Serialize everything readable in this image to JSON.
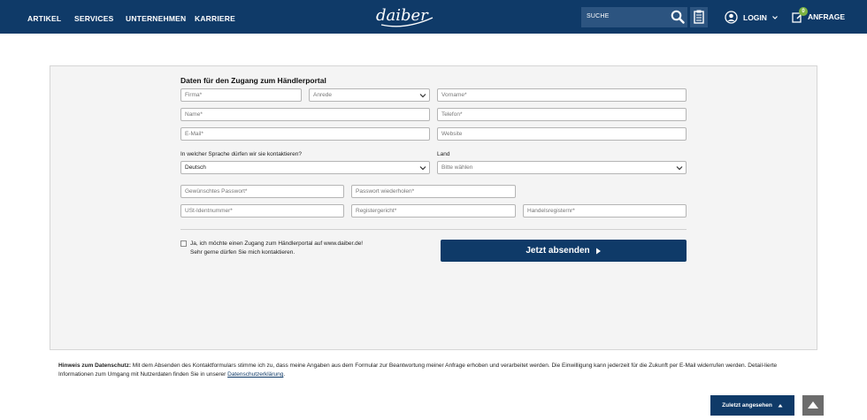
{
  "header": {
    "nav": [
      "ARTIKEL",
      "SERVICES",
      "UNTERNEHMEN",
      "KARRIERE"
    ],
    "logo_text": "daiber",
    "search_placeholder": "SUCHE",
    "login_label": "LOGIN",
    "request_label": "ANFRAGE",
    "request_count": "0"
  },
  "form": {
    "title": "Daten für den Zugang zum Händlerportal",
    "company": "Firma*",
    "salutation": "Anrede",
    "firstname": "Vorname*",
    "name": "Name*",
    "phone": "Telefon*",
    "email": "E-Mail*",
    "website": "Website",
    "language_label": "In welcher Sprache dürfen wir sie kontaktieren?",
    "language_value": "Deutsch",
    "country_label": "Land",
    "country_value": "Bitte wählen",
    "password": "Gewünschtes Passwort*",
    "password_repeat": "Passwort wiederholen*",
    "vat_id": "USt-Identnummer*",
    "court": "Registergericht*",
    "register_no": "Handelsregisternr*",
    "consent_line1": "Ja, ich möchte einen Zugang zum Händlerportal auf www.daiber.de!",
    "consent_line2": "Sehr gerne dürfen Sie mich kontaktieren.",
    "submit_label": "Jetzt absenden"
  },
  "privacy": {
    "heading": "Hinweis zum Datenschutz:",
    "text": " Mit dem Absenden des Kontaktformulars stimme ich zu, dass meine Angaben aus dem Formular zur Beantwortung meiner Anfrage erhoben und verarbeitet werden. Die Einwilligung kann jederzeit für die Zukunft per E-Mail widerrufen werden. Detail-lierte Informationen zum Umgang mit Nutzerdaten finden Sie in unserer ",
    "link": "Datenschutzerklärung",
    "end": "."
  },
  "footer": {
    "recently_viewed": "Zuletzt angesehen"
  },
  "colors": {
    "brand": "#0f3a68",
    "badge": "#7cb342"
  }
}
